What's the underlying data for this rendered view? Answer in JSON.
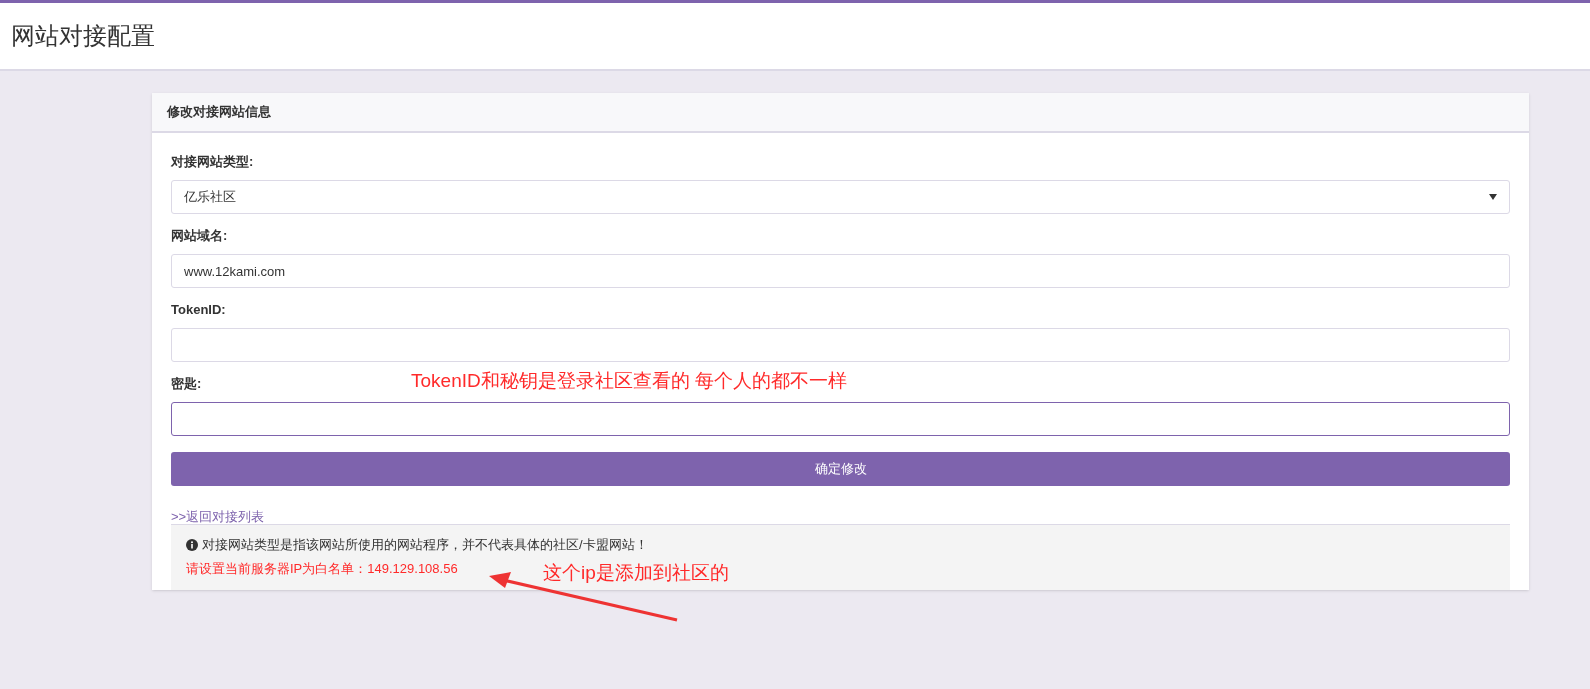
{
  "page": {
    "title": "网站对接配置"
  },
  "card": {
    "title": "修改对接网站信息",
    "fields": [
      {
        "kind": "select",
        "label": "对接网站类型:",
        "value": "亿乐社区",
        "focused": false
      },
      {
        "kind": "text",
        "label": "网站域名:",
        "value": "www.12kami.com",
        "focused": false
      },
      {
        "kind": "text",
        "label": "TokenID:",
        "focused": false
      },
      {
        "kind": "text",
        "label": "密匙:",
        "focused": true
      }
    ],
    "submit": "确定修改",
    "back_link": ">>返回对接列表",
    "info": {
      "note": "对接网站类型是指该网站所使用的网站程序，并不代表具体的社区/卡盟网站！",
      "warning": "请设置当前服务器IP为白名单：149.129.108.56"
    }
  },
  "annotations": [
    {
      "text": "TokenID和秘钥是登录社区查看的 每个人的都不一样"
    },
    {
      "text": "这个ip是添加到社区的"
    }
  ]
}
